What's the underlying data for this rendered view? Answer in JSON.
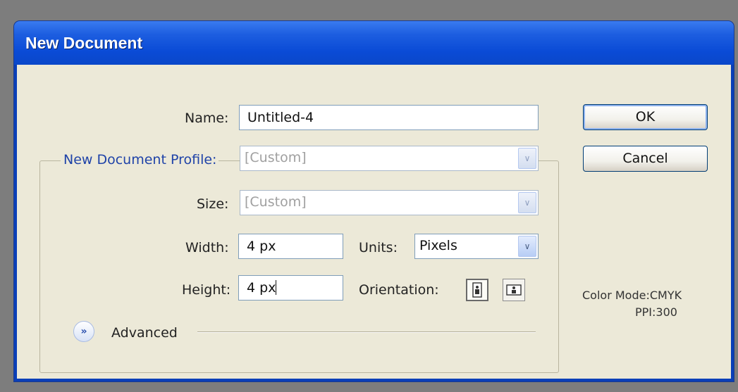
{
  "window": {
    "title": "New Document"
  },
  "form": {
    "name_label": "Name:",
    "name_value": "Untitled-4",
    "profile_label": "New Document Profile:",
    "profile_value": "[Custom]",
    "size_label": "Size:",
    "size_value": "[Custom]",
    "width_label": "Width:",
    "width_value": "4 px",
    "units_label": "Units:",
    "units_value": "Pixels",
    "height_label": "Height:",
    "height_value": "4 px",
    "orientation_label": "Orientation:",
    "orientation_selected": "portrait",
    "advanced_label": "Advanced"
  },
  "buttons": {
    "ok_label": "OK",
    "cancel_label": "Cancel"
  },
  "info": {
    "color_mode": "Color Mode:CMYK",
    "ppi": "PPI:300"
  },
  "icons": {
    "dropdown": "chevron-down-icon",
    "advanced": "double-chevron-down-icon",
    "portrait": "portrait-orientation-icon",
    "landscape": "landscape-orientation-icon"
  },
  "colors": {
    "titlebar": "#0a4bd6",
    "client": "#ece9d8",
    "profile_label": "#1f43a8"
  }
}
